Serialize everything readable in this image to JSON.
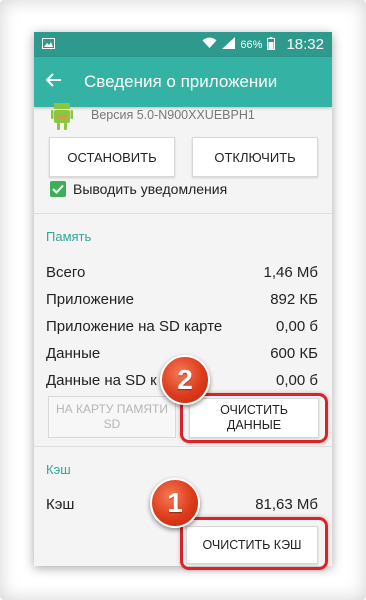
{
  "status_bar": {
    "battery_percent": "66%",
    "time": "18:32",
    "left_icon": "image-icon",
    "icons": [
      "wifi-icon",
      "signal-icon",
      "battery-icon"
    ]
  },
  "app_bar": {
    "title": "Сведения о приложении",
    "back_icon": "back-arrow-icon"
  },
  "app_info": {
    "version": "Версия 5.0-N900XXUEBPH1",
    "icon": "android-icon"
  },
  "actions": {
    "stop_label": "ОСТАНОВИТЬ",
    "disable_label": "ОТКЛЮЧИТЬ"
  },
  "notifications": {
    "label": "Выводить уведомления",
    "checked": true
  },
  "memory": {
    "section_title": "Память",
    "rows": [
      {
        "label": "Всего",
        "value": "1,46 Мб"
      },
      {
        "label": "Приложение",
        "value": "892 КБ"
      },
      {
        "label": "Приложение на SD карте",
        "value": "0,00 б"
      },
      {
        "label": "Данные",
        "value": "600 КБ"
      },
      {
        "label": "Данные на SD к",
        "value": "0,00 б"
      }
    ],
    "move_sd_label_line1": "НА КАРТУ ПАМЯТИ",
    "move_sd_label_line2": "SD",
    "clear_data_line1": "ОЧИСТИТЬ",
    "clear_data_line2": "ДАННЫЕ"
  },
  "cache": {
    "section_title": "Кэш",
    "row": {
      "label": "Кэш",
      "value": "81,63 Мб"
    },
    "clear_cache_label": "ОЧИСТИТЬ КЭШ"
  },
  "annotations": {
    "badge_1": "1",
    "badge_2": "2",
    "accent_color": "#d9232a"
  },
  "colors": {
    "status_bar": "#2e9a8e",
    "app_bar": "#34b3a4",
    "section_title": "#2ea898",
    "checkbox": "#3fae58"
  }
}
